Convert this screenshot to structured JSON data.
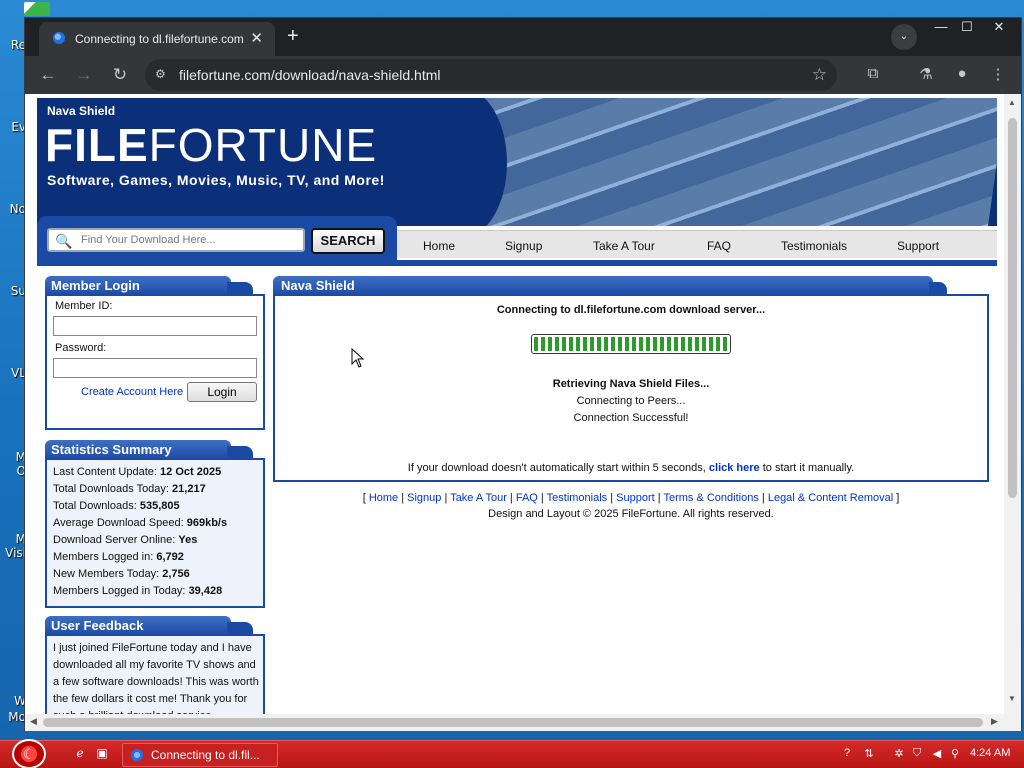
{
  "desktop": {
    "icons": [
      "Re",
      "Ev",
      "No",
      "Su",
      "VL",
      "M",
      "O",
      "M",
      "Visi",
      "W",
      "Mo"
    ]
  },
  "browser": {
    "tab_title": "Connecting to dl.filefortune.com",
    "url": "filefortune.com/download/nava-shield.html"
  },
  "site": {
    "product_name": "Nava Shield",
    "logo_bold": "FILE",
    "logo_light": "FORTUNE",
    "tagline": "Software, Games, Movies, Music, TV, and More!",
    "search": {
      "placeholder": "Find Your Download Here...",
      "button": "SEARCH"
    },
    "menu": [
      "Home",
      "Signup",
      "Take A Tour",
      "FAQ",
      "Testimonials",
      "Support"
    ],
    "login": {
      "title": "Member Login",
      "member_id_label": "Member ID:",
      "password_label": "Password:",
      "create_link": "Create Account Here",
      "login_button": "Login"
    },
    "stats": {
      "title": "Statistics Summary",
      "rows": [
        {
          "label": "Last Content Update:",
          "value": "12 Oct 2025"
        },
        {
          "label": "Total Downloads Today:",
          "value": "21,217"
        },
        {
          "label": "Total Downloads:",
          "value": "535,805"
        },
        {
          "label": "Average Download Speed:",
          "value": "969kb/s"
        },
        {
          "label": "Download Server Online:",
          "value": "Yes"
        },
        {
          "label": "Members Logged in:",
          "value": "6,792"
        },
        {
          "label": "New Members Today:",
          "value": "2,756"
        },
        {
          "label": "Members Logged in Today:",
          "value": "39,428"
        }
      ]
    },
    "feedback": {
      "title": "User Feedback",
      "text": "I just joined FileFortune today and I have downloaded all my favorite TV shows and a few software downloads! This was worth the few dollars it cost me! Thank you for such a brilliant download service."
    },
    "main": {
      "title": "Nava Shield",
      "connecting": "Connecting to dl.filefortune.com download server...",
      "progress": 1.0,
      "retrieving": "Retrieving Nava Shield Files...",
      "peers": "Connecting to Peers...",
      "success": "Connection Successful!",
      "manual_prefix": "If your download doesn't automatically start within 5 seconds,",
      "manual_link": "click here",
      "manual_suffix": "to start it manually."
    },
    "footer": {
      "links": [
        "Home",
        "Signup",
        "Take A Tour",
        "FAQ",
        "Testimonials",
        "Support",
        "Terms & Conditions",
        "Legal & Content Removal"
      ],
      "copyright": "Design and Layout © 2025 FileFortune. All rights reserved."
    }
  },
  "taskbar": {
    "task_label": "Connecting to dl.fil...",
    "clock": "4:24 AM"
  }
}
